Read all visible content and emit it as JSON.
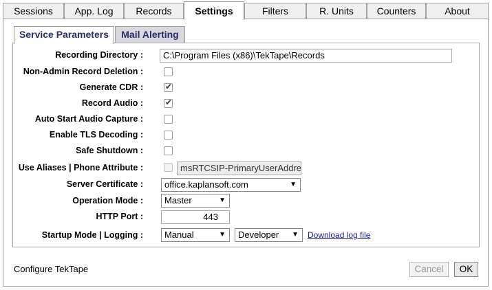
{
  "top_tabs": [
    {
      "label": "Sessions"
    },
    {
      "label": "App. Log"
    },
    {
      "label": "Records"
    },
    {
      "label": "Settings",
      "active": true
    },
    {
      "label": "Filters"
    },
    {
      "label": "R. Units"
    },
    {
      "label": "Counters"
    },
    {
      "label": "About"
    }
  ],
  "sub_tabs": [
    {
      "label": "Service Parameters",
      "active": true
    },
    {
      "label": "Mail Alerting"
    }
  ],
  "form": {
    "recording_directory": {
      "label": "Recording Directory :",
      "value": "C:\\Program Files (x86)\\TekTape\\Records"
    },
    "non_admin_record_deletion": {
      "label": "Non-Admin Record Deletion :",
      "checked": false
    },
    "generate_cdr": {
      "label": "Generate CDR :",
      "checked": true
    },
    "record_audio": {
      "label": "Record Audio :",
      "checked": true
    },
    "auto_start_audio_capture": {
      "label": "Auto Start Audio Capture :",
      "checked": false
    },
    "enable_tls_decoding": {
      "label": "Enable TLS Decoding :",
      "checked": false
    },
    "safe_shutdown": {
      "label": "Safe Shutdown :",
      "checked": false
    },
    "use_aliases": {
      "label": "Use Aliases | Phone Attribute :",
      "checked": false,
      "phone_attribute": "msRTCSIP-PrimaryUserAddre"
    },
    "server_certificate": {
      "label": "Server Certificate :",
      "value": "office.kaplansoft.com"
    },
    "operation_mode": {
      "label": "Operation Mode :",
      "value": "Master"
    },
    "http_port": {
      "label": "HTTP Port :",
      "value": "443"
    },
    "startup_logging": {
      "label": "Startup Mode | Logging :",
      "startup_value": "Manual",
      "logging_value": "Developer",
      "download_link": "Download log file"
    }
  },
  "footer": {
    "status_text": "Configure TekTape",
    "cancel_label": "Cancel",
    "ok_label": "OK"
  },
  "colors": {
    "subtab_text": "#2b2b6b",
    "link": "#1a1aa6",
    "border": "#999999"
  }
}
